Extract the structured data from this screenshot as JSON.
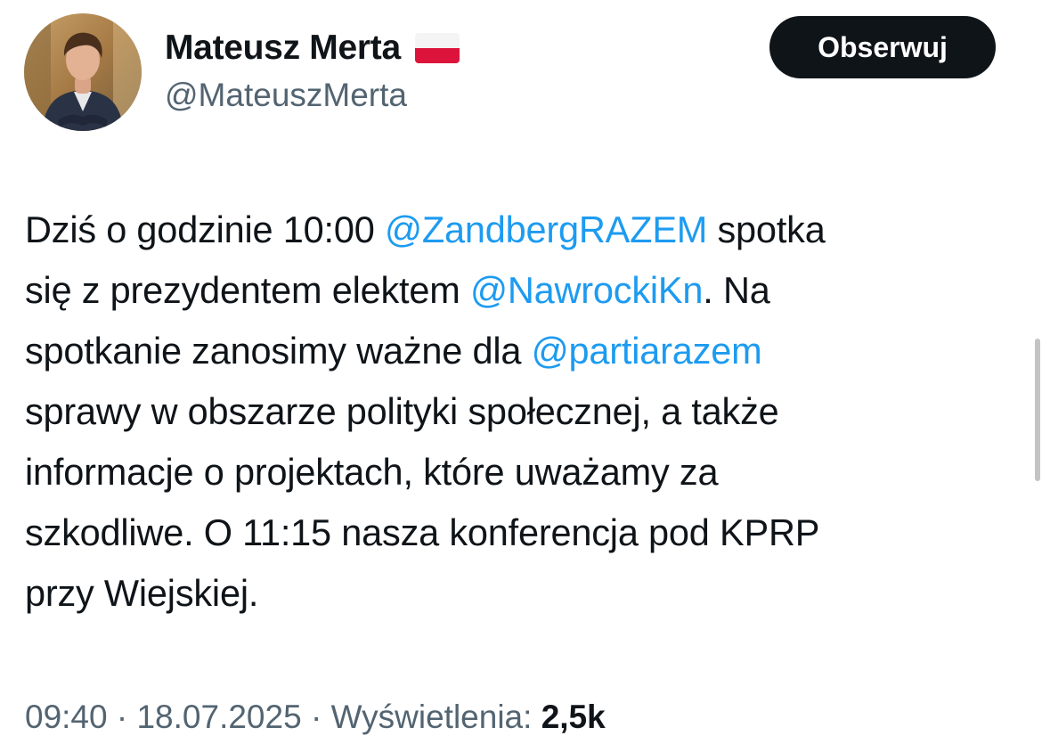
{
  "author": {
    "display_name": "Mateusz Merta",
    "handle": "@MateuszMerta",
    "flag_icon": "poland-flag-icon",
    "avatar_icon": "profile-photo"
  },
  "follow_button": {
    "label": "Obserwuj"
  },
  "tweet": {
    "lines": [
      [
        {
          "text": "Dziś o godzinie 10:00 ",
          "type": "text"
        },
        {
          "text": "@ZandbergRAZEM",
          "type": "mention"
        },
        {
          "text": " spotka",
          "type": "text"
        }
      ],
      [
        {
          "text": "się z prezydentem elektem ",
          "type": "text"
        },
        {
          "text": "@NawrockiKn",
          "type": "mention"
        },
        {
          "text": ". Na",
          "type": "text"
        }
      ],
      [
        {
          "text": "spotkanie zanosimy ważne dla ",
          "type": "text"
        },
        {
          "text": "@partiarazem",
          "type": "mention"
        }
      ],
      [
        {
          "text": "sprawy w obszarze polityki społecznej, a także",
          "type": "text"
        }
      ],
      [
        {
          "text": "informacje o projektach, które uważamy za",
          "type": "text"
        }
      ],
      [
        {
          "text": "szkodliwe. O 11:15 nasza konferencja pod KPRP",
          "type": "text"
        }
      ],
      [
        {
          "text": "przy Wiejskiej.",
          "type": "text"
        }
      ]
    ]
  },
  "meta": {
    "time": "09:40",
    "separator": " · ",
    "date": "18.07.2025",
    "views_label": "Wyświetlenia:",
    "views_count": "2,5k"
  },
  "colors": {
    "text": "#0f1419",
    "secondary": "#536471",
    "link": "#1d9bf0",
    "button_bg": "#0f1419",
    "button_text": "#ffffff"
  }
}
